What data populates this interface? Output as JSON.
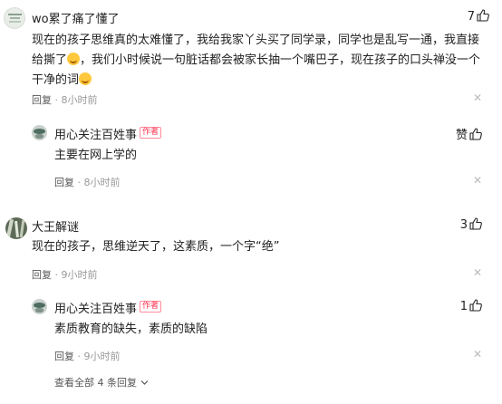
{
  "comments": [
    {
      "username": "wo累了痛了懂了",
      "likes": "7",
      "text_parts": [
        "现在的孩子思维真的太难懂了，我给我家丫头买了同学录，同学也是乱写一通，我直接给撕了",
        "，我们小时候说一句脏话都会被家长抽一个嘴巴子，现在孩子的口头禅没一个干净的词"
      ],
      "reply_label": "回复",
      "time": "8小时前"
    },
    {
      "username": "用心关注百姓事",
      "author_tag": "作者",
      "like_label": "赞",
      "text": "主要在网上学的",
      "reply_label": "回复",
      "time": "8小时前"
    },
    {
      "username": "大王解谜",
      "likes": "3",
      "text": "现在的孩子，思维逆天了，这素质，一个字“绝”",
      "reply_label": "回复",
      "time": "9小时前"
    },
    {
      "username": "用心关注百姓事",
      "author_tag": "作者",
      "likes": "1",
      "text": "素质教育的缺失，素质的缺陷",
      "reply_label": "回复",
      "time": "9小时前"
    }
  ],
  "view_all_replies": "查看全部 4 条回复",
  "separator": "·",
  "icons": [
    "thumb-up-icon",
    "close-icon",
    "chevron-down-icon",
    "grin-emoji-icon"
  ]
}
